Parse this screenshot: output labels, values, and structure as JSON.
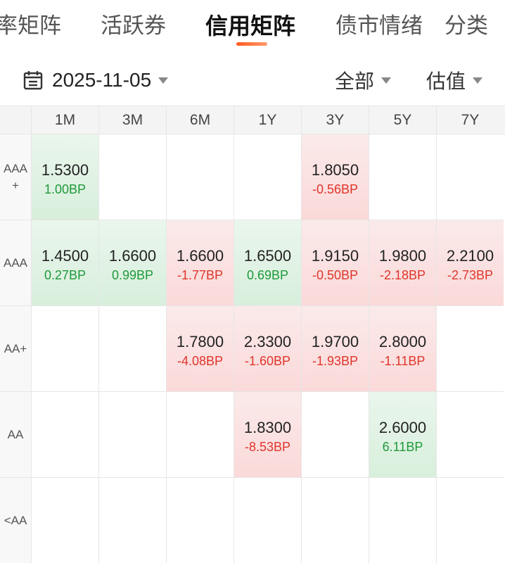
{
  "tabs": [
    {
      "label": "率矩阵",
      "active": false
    },
    {
      "label": "活跃券",
      "active": false
    },
    {
      "label": "信用矩阵",
      "active": true
    },
    {
      "label": "债市情绪",
      "active": false
    },
    {
      "label": "分类",
      "active": false
    }
  ],
  "filters": {
    "date": "2025-11-05",
    "scope": "全部",
    "metric": "估值"
  },
  "colors": {
    "accent": "#ff5a1f",
    "up_text": "#e0352b",
    "down_text": "#1e9a3a",
    "up_bg": "#fbd9d9",
    "down_bg": "#d8efdc"
  },
  "matrix": {
    "columns": [
      "1M",
      "3M",
      "6M",
      "1Y",
      "3Y",
      "5Y",
      "7Y"
    ],
    "rows": [
      {
        "label": "AAA\n+",
        "cells": [
          {
            "value": "1.5300",
            "change": "1.00BP",
            "dir": "down"
          },
          null,
          null,
          null,
          {
            "value": "1.8050",
            "change": "-0.56BP",
            "dir": "up"
          },
          null,
          null
        ]
      },
      {
        "label": "AAA",
        "cells": [
          {
            "value": "1.4500",
            "change": "0.27BP",
            "dir": "down"
          },
          {
            "value": "1.6600",
            "change": "0.99BP",
            "dir": "down"
          },
          {
            "value": "1.6600",
            "change": "-1.77BP",
            "dir": "up"
          },
          {
            "value": "1.6500",
            "change": "0.69BP",
            "dir": "down"
          },
          {
            "value": "1.9150",
            "change": "-0.50BP",
            "dir": "up"
          },
          {
            "value": "1.9800",
            "change": "-2.18BP",
            "dir": "up"
          },
          {
            "value": "2.2100",
            "change": "-2.73BP",
            "dir": "up"
          }
        ]
      },
      {
        "label": "AA+",
        "cells": [
          null,
          null,
          {
            "value": "1.7800",
            "change": "-4.08BP",
            "dir": "up"
          },
          {
            "value": "2.3300",
            "change": "-1.60BP",
            "dir": "up"
          },
          {
            "value": "1.9700",
            "change": "-1.93BP",
            "dir": "up"
          },
          {
            "value": "2.8000",
            "change": "-1.11BP",
            "dir": "up"
          },
          null
        ]
      },
      {
        "label": "AA",
        "cells": [
          null,
          null,
          null,
          {
            "value": "1.8300",
            "change": "-8.53BP",
            "dir": "up"
          },
          null,
          {
            "value": "2.6000",
            "change": "6.11BP",
            "dir": "down"
          },
          null
        ]
      },
      {
        "label": "<AA",
        "cells": [
          null,
          null,
          null,
          null,
          null,
          null,
          null
        ]
      }
    ]
  }
}
